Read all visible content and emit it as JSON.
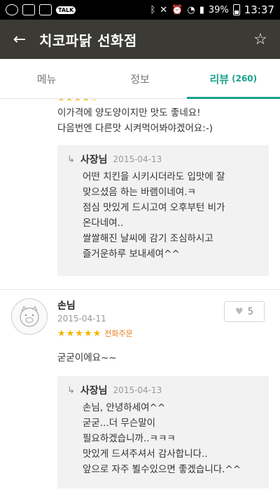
{
  "status_bar": {
    "battery": "39%",
    "time": "13:37",
    "talk_label": "TALK"
  },
  "app_bar": {
    "back_icon": "←",
    "title": "치코파닭 선화점",
    "favorite_icon": "☆"
  },
  "tabs": [
    {
      "label": "메뉴"
    },
    {
      "label": "정보"
    },
    {
      "label": "리뷰",
      "count": "(260)"
    }
  ],
  "review1": {
    "text_line1": "이가격에 양도양이지만 맛도 좋네요!",
    "text_line2": "다음번엔 다른맛 시켜먹어봐야겠어요:-)",
    "reply": {
      "arrow": "↳",
      "author": "사장님",
      "date": "2015-04-13",
      "lines": [
        "어떤 치킨을 시키시더라도 입맛에 잘",
        "맞으셨음 하는 바램이네여.ㅋ",
        "점심 맛있게 드시고여 오후부턴 비가",
        "온다네여..",
        "쌀쌀해진 날씨에 감기 조심하시고",
        "즐거운하루 보내세여^^"
      ]
    }
  },
  "review2": {
    "author": "손님",
    "date": "2015-04-11",
    "stars": "★★★★★",
    "order_type": "전화주문",
    "likes": "5",
    "text": "굳굳이에요~~",
    "reply": {
      "arrow": "↳",
      "author": "사장님",
      "date": "2015-04-13",
      "lines": [
        "손님, 안녕하세여^^",
        "굳굳...더 무슨말이",
        "필요하겠습니까..ㅋㅋㅋ",
        "맛있게 드셔주셔서 감사합니다..",
        "앞으로 자주 뵐수있으면 좋겠습니다.^^"
      ]
    }
  },
  "colors": {
    "accent": "#1aa18c",
    "appbar": "#3b3a35",
    "star": "#f4b400"
  }
}
